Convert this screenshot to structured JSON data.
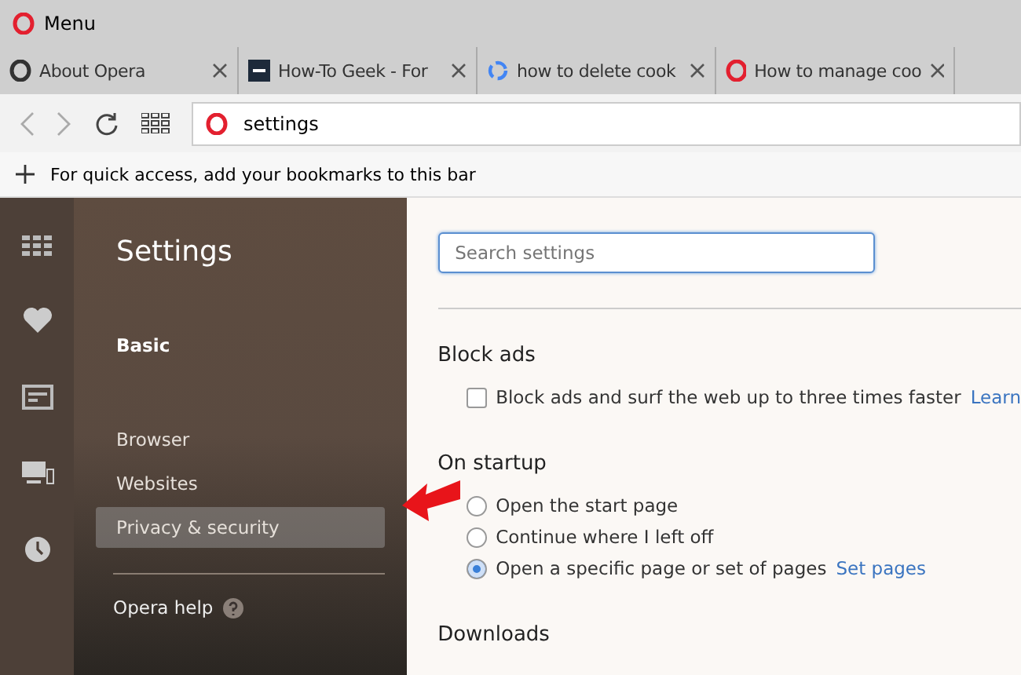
{
  "window": {
    "title": "Menu"
  },
  "tabs": [
    {
      "label": "About Opera"
    },
    {
      "label": "How-To Geek - For"
    },
    {
      "label": "how to delete cook"
    },
    {
      "label": "How to manage coo"
    }
  ],
  "address_bar": {
    "value": "settings"
  },
  "bookmarks_bar": {
    "hint": "For quick access, add your bookmarks to this bar"
  },
  "sidebar": {
    "title": "Settings",
    "items": [
      {
        "label": "Basic",
        "kind": "heading",
        "selected": true
      },
      {
        "label": "Browser",
        "kind": "link",
        "selected": false
      },
      {
        "label": "Websites",
        "kind": "link",
        "selected": false
      },
      {
        "label": "Privacy & security",
        "kind": "link",
        "selected": false,
        "hovered": true
      }
    ],
    "help": "Opera help"
  },
  "search": {
    "placeholder": "Search settings"
  },
  "sections": [
    {
      "title": "Block ads",
      "options": [
        {
          "kind": "checkbox",
          "label": "Block ads and surf the web up to three times faster",
          "checked": false,
          "link": "Learn"
        }
      ]
    },
    {
      "title": "On startup",
      "options": [
        {
          "kind": "radio",
          "label": "Open the start page",
          "checked": false
        },
        {
          "kind": "radio",
          "label": "Continue where I left off",
          "checked": false
        },
        {
          "kind": "radio",
          "label": "Open a specific page or set of pages",
          "checked": true,
          "link": "Set pages"
        }
      ]
    },
    {
      "title": "Downloads"
    }
  ]
}
